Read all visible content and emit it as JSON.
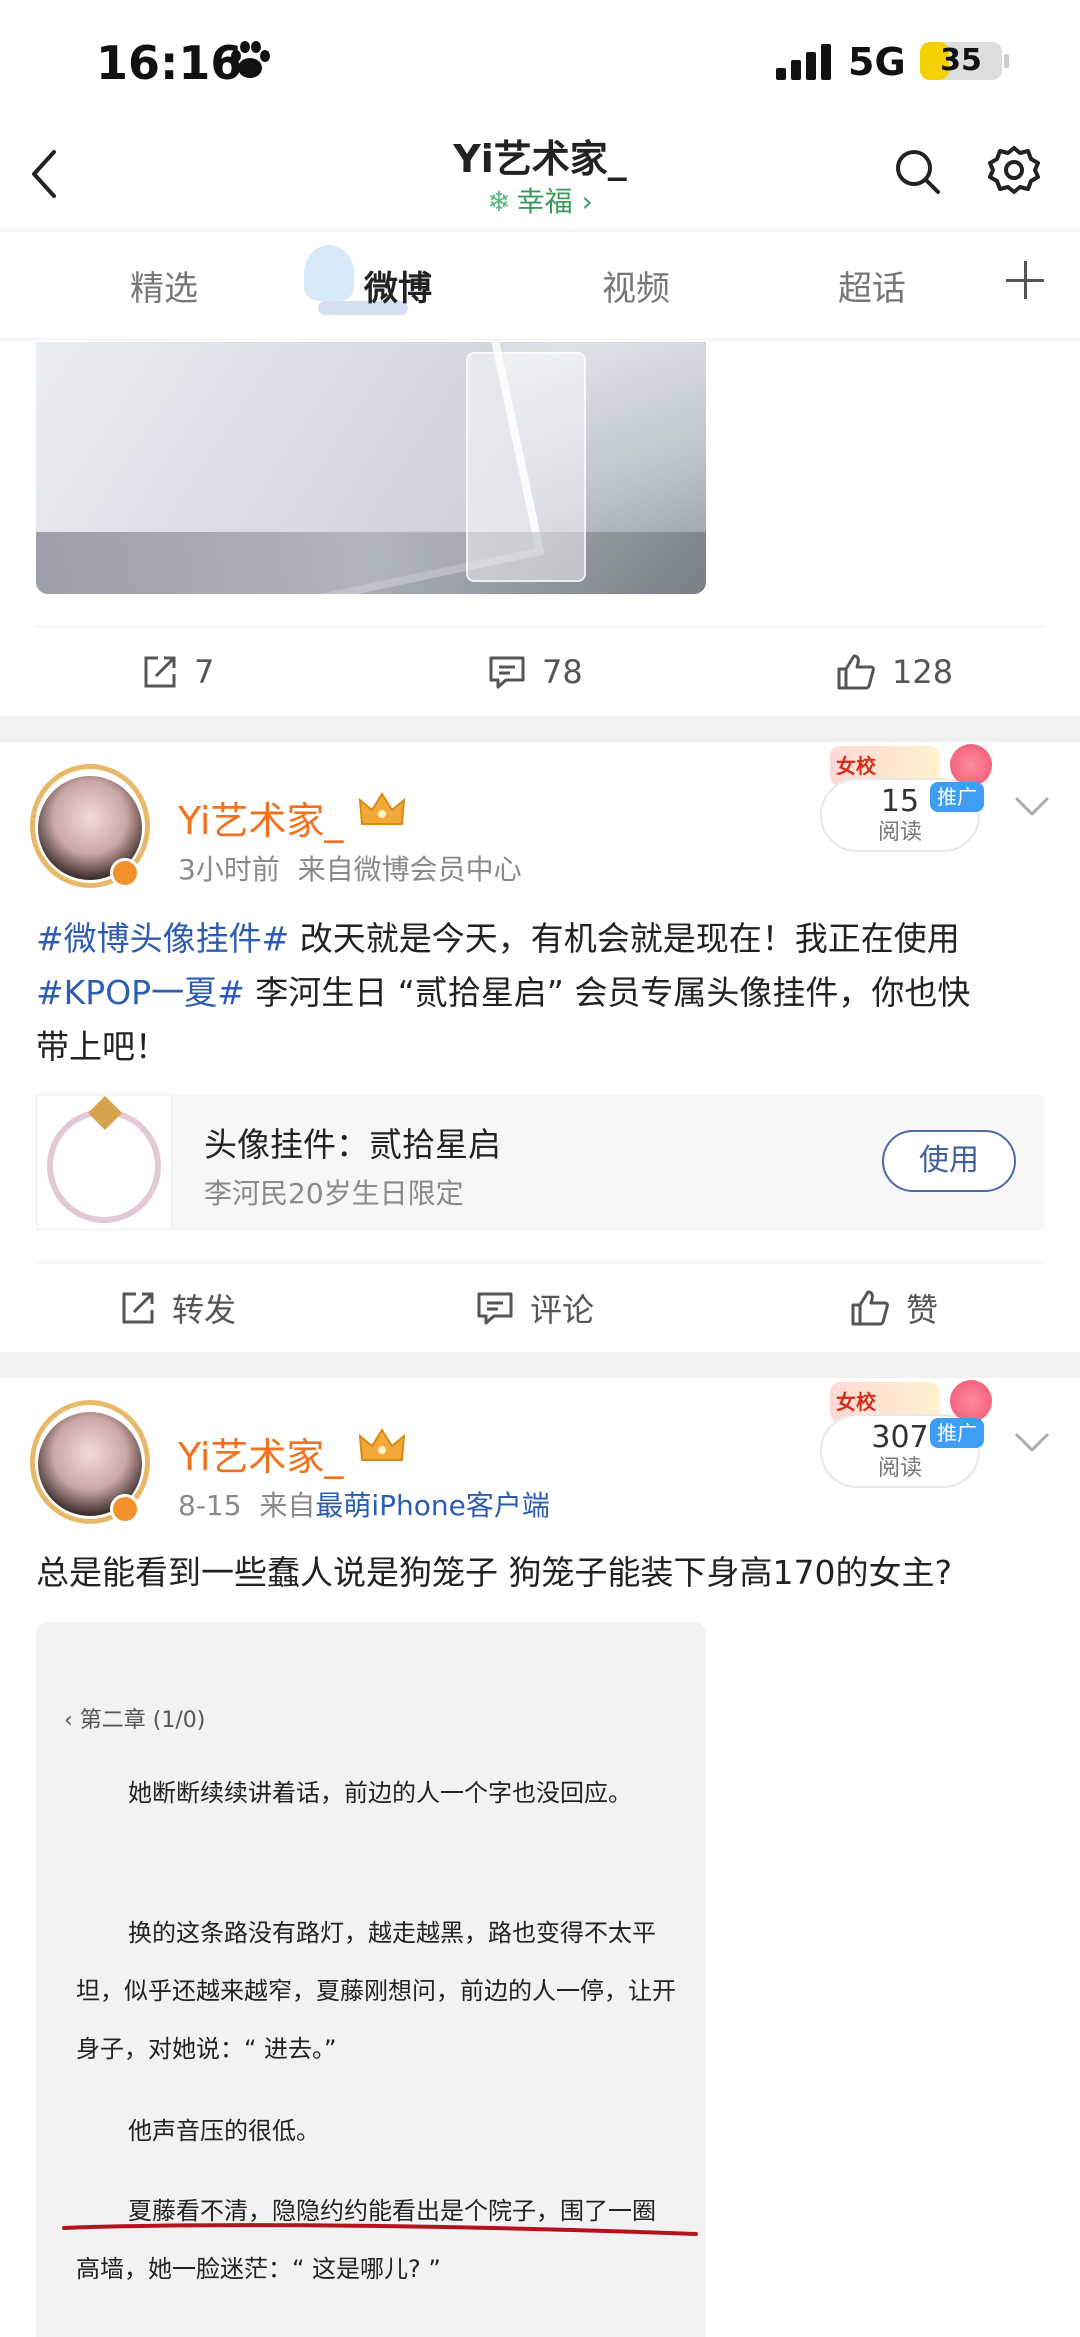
{
  "status_bar": {
    "time": "16:16",
    "network": "5G",
    "battery": "35",
    "battery_level": 0.35
  },
  "header": {
    "title": "Yi艺术家_",
    "subtitle": "幸福 ›",
    "subtitle_icon": "snowflake-icon"
  },
  "tabs": [
    {
      "label": "精选",
      "active": false
    },
    {
      "label": "微博",
      "active": true
    },
    {
      "label": "视频",
      "active": false
    },
    {
      "label": "超话",
      "active": false
    }
  ],
  "post1_actions": {
    "repost": "7",
    "comment": "78",
    "like": "128"
  },
  "post2": {
    "username": "Yi艺术家_",
    "time": "3小时前",
    "source_prefix": "来自",
    "source": "微博会员中心",
    "promo": {
      "count": "15",
      "reads": "阅读",
      "tag": "推广",
      "school": "女校"
    },
    "text": {
      "tag1": "#微博头像挂件#",
      "line1": " 改天就是今天，有机会就是现在！我正在使用",
      "tag2": "#KPOP一夏#",
      "line2": " 李河生日 “贰拾星启” 会员专属头像挂件，你也快",
      "line3": "带上吧！"
    },
    "widget": {
      "title": "头像挂件：贰拾星启",
      "subtitle": "李河民20岁生日限定",
      "button": "使用"
    },
    "actions": {
      "repost": "转发",
      "comment": "评论",
      "like": "赞"
    }
  },
  "post3": {
    "username": "Yi艺术家_",
    "time": "8-15",
    "source_prefix": "来自",
    "source": "最萌iPhone客户端",
    "promo": {
      "count": "307",
      "reads": "阅读",
      "tag": "推广",
      "school": "女校"
    },
    "text": "总是能看到一些蠢人说是狗笼子 狗笼子能装下身高170的女主?",
    "book": {
      "chapter": "‹ 第二章 (1/0)",
      "paragraphs": [
        "她断断续续讲着话，前边的人一个字也没回应。",
        "换的这条路没有路灯，越走越黑，路也变得不太平坦，似乎还越来越窄，夏藤刚想问，前边的人一停，让开身子，对她说：“ 进去。”",
        "他声音压的很低。",
        "夏藤看不清，隐隐约约能看出是个院子，围了一圈高墙，她一脸迷茫：“ 这是哪儿? ”"
      ]
    }
  }
}
